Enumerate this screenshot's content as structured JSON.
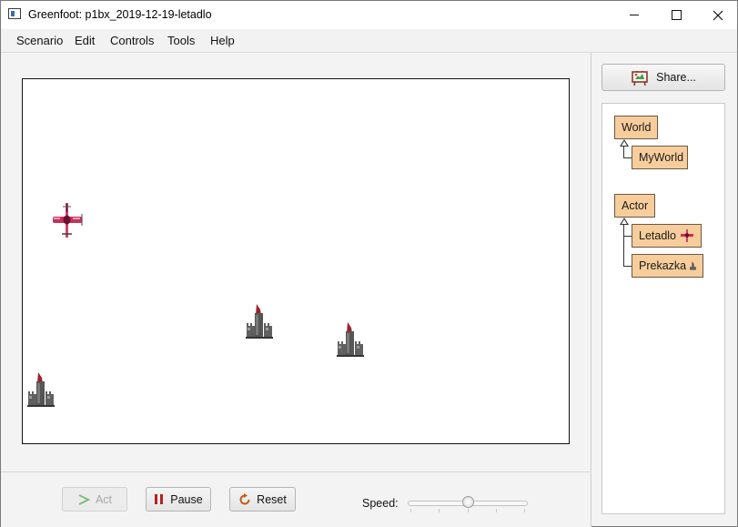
{
  "window": {
    "title": "Greenfoot: p1bx_2019-12-19-letadlo",
    "minimize_icon": "minimize-icon",
    "maximize_icon": "maximize-icon",
    "close_icon": "close-icon"
  },
  "menu": {
    "items": [
      "Scenario",
      "Edit",
      "Controls",
      "Tools",
      "Help"
    ]
  },
  "world": {
    "actors": [
      {
        "class": "Letadlo",
        "icon": "airplane-icon"
      },
      {
        "class": "Prekazka",
        "icon": "tower-icon"
      },
      {
        "class": "Prekazka",
        "icon": "tower-icon"
      },
      {
        "class": "Prekazka",
        "icon": "tower-icon"
      }
    ]
  },
  "controls": {
    "act_label": "Act",
    "pause_label": "Pause",
    "reset_label": "Reset",
    "speed_label": "Speed:",
    "speed_value": 0.5
  },
  "share": {
    "label": "Share...",
    "icon": "share-easel-icon"
  },
  "class_tree": {
    "world_root": "World",
    "world_subclass": "MyWorld",
    "actor_root": "Actor",
    "actor_subclasses": [
      "Letadlo",
      "Prekazka"
    ]
  },
  "colors": {
    "class_box": "#f7cd9c",
    "act_arrow": "#7ac07a",
    "pause_bars": "#b22222",
    "reset_arrow": "#c25a1a"
  }
}
